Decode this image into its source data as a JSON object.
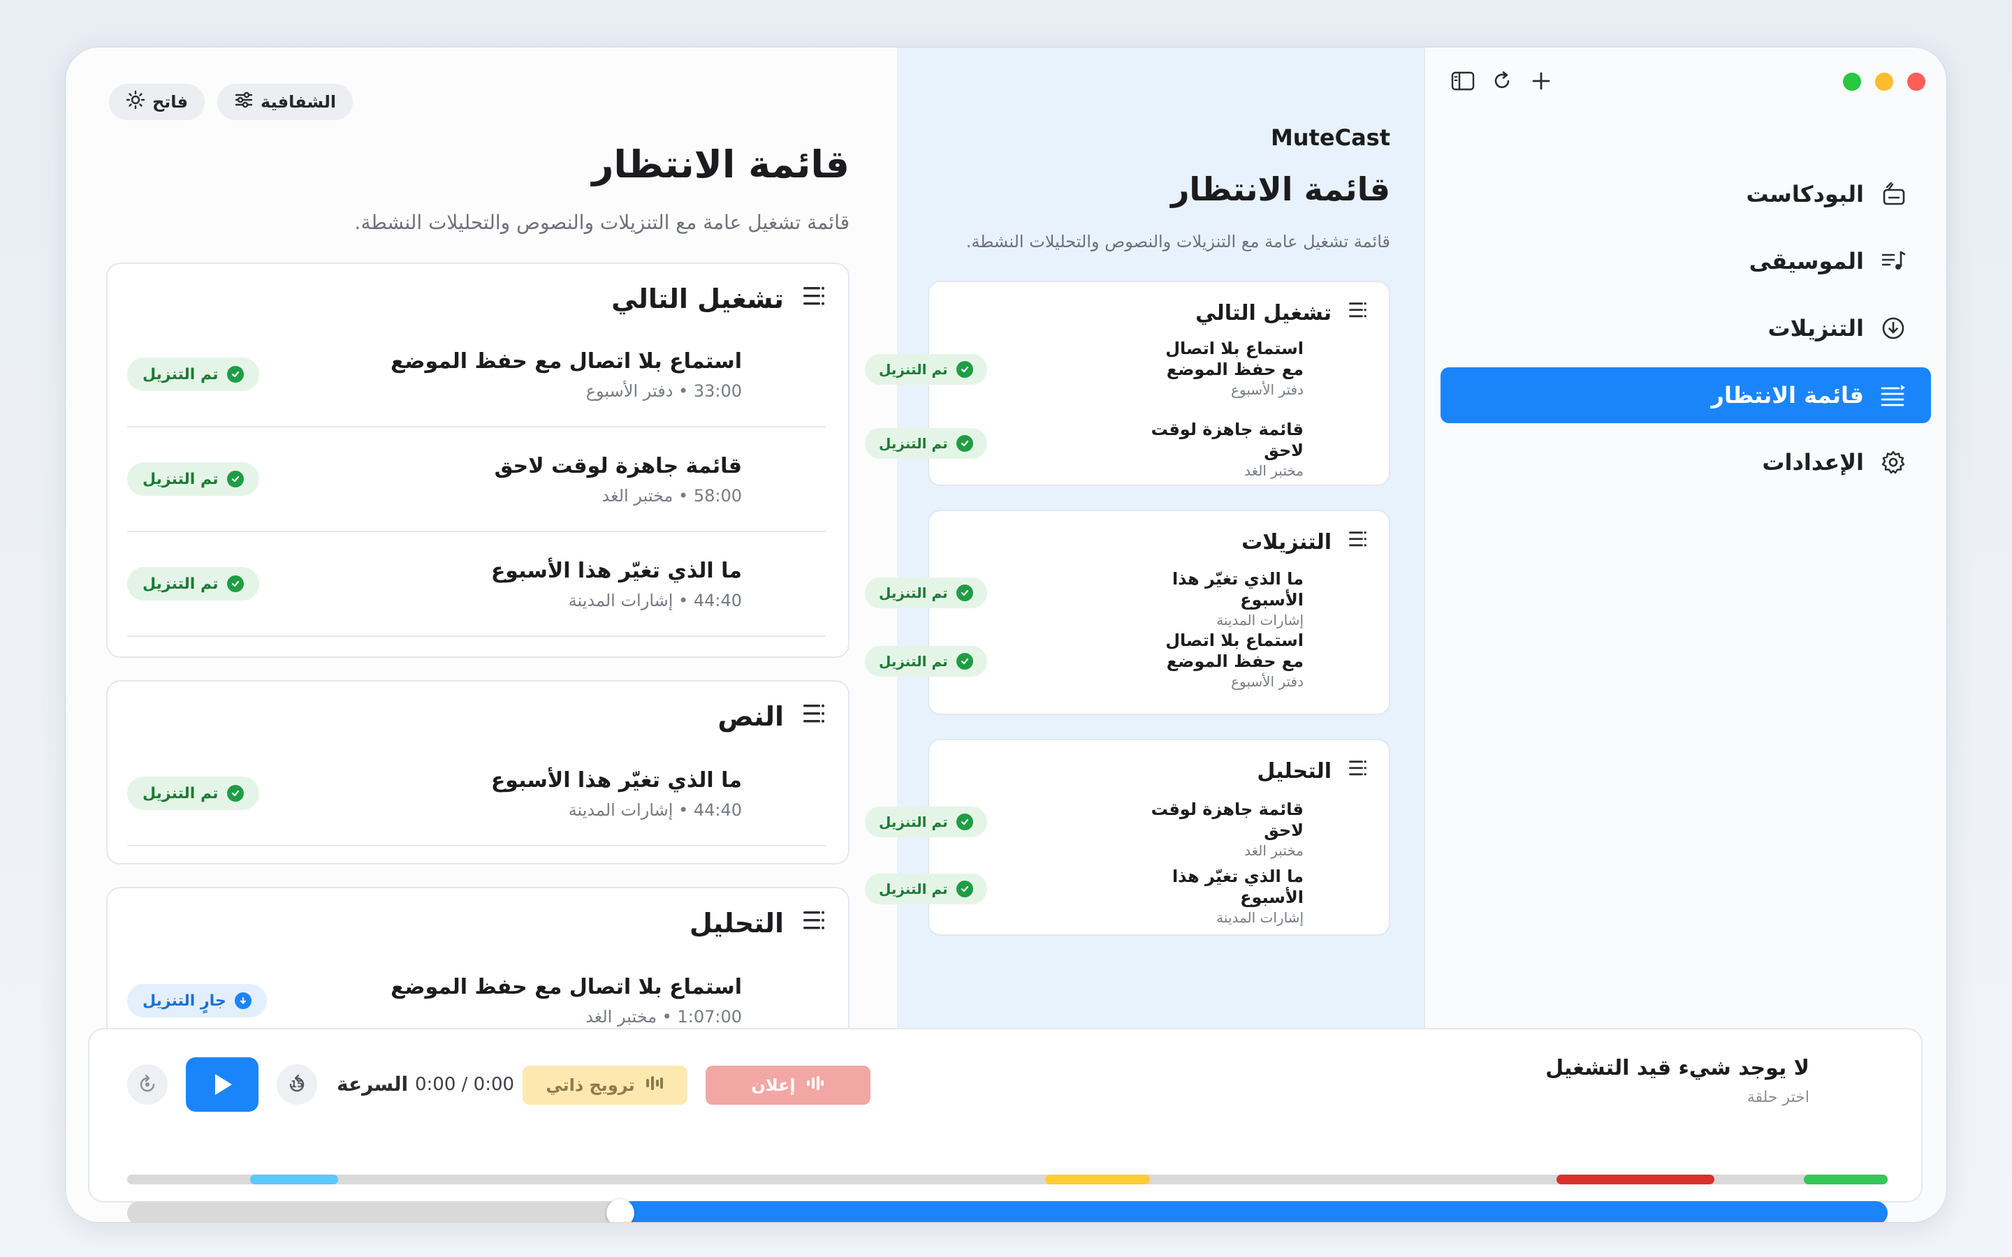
{
  "app": {
    "name": "MuteCast"
  },
  "sidebar": {
    "items": [
      {
        "label": "البودكاست",
        "icon": "podcast-icon"
      },
      {
        "label": "الموسيقى",
        "icon": "music-icon"
      },
      {
        "label": "التنزيلات",
        "icon": "download-icon"
      },
      {
        "label": "قائمة الانتظار",
        "icon": "queue-icon",
        "active": true
      },
      {
        "label": "الإعدادات",
        "icon": "gear-icon"
      }
    ]
  },
  "middle": {
    "title": "قائمة الانتظار",
    "subtitle": "قائمة تشغيل عامة مع التنزيلات والنصوص والتحليلات النشطة.",
    "cards": [
      {
        "title": "تشغيل التالي",
        "rows": [
          {
            "title": "استماع بلا اتصال مع حفظ الموضع",
            "subtitle": "دفتر الأسبوع",
            "badge": "تم التنزيل"
          },
          {
            "title": "قائمة جاهزة لوقت لاحق",
            "subtitle": "مختبر الغد",
            "badge": "تم التنزيل"
          }
        ]
      },
      {
        "title": "التنزيلات",
        "rows": [
          {
            "title": "ما الذي تغيّر هذا الأسبوع",
            "subtitle": "إشارات المدينة",
            "badge": "تم التنزيل"
          },
          {
            "title": "استماع بلا اتصال مع حفظ الموضع",
            "subtitle": "دفتر الأسبوع",
            "badge": "تم التنزيل"
          }
        ]
      },
      {
        "title": "التحليل",
        "rows": [
          {
            "title": "قائمة جاهزة لوقت لاحق",
            "subtitle": "مختبر الغد",
            "badge": "تم التنزيل"
          },
          {
            "title": "ما الذي تغيّر هذا الأسبوع",
            "subtitle": "إشارات المدينة",
            "badge": "تم التنزيل"
          }
        ]
      }
    ]
  },
  "main": {
    "pills": {
      "transparency": "الشفافية",
      "theme": "فاتح"
    },
    "title": "قائمة الانتظار",
    "subtitle": "قائمة تشغيل عامة مع التنزيلات والنصوص والتحليلات النشطة.",
    "cards": [
      {
        "title": "تشغيل التالي",
        "rows": [
          {
            "title": "استماع بلا اتصال مع حفظ الموضع",
            "subtitle": "33:00 • دفتر الأسبوع",
            "badge": "تم التنزيل"
          },
          {
            "title": "قائمة جاهزة لوقت لاحق",
            "subtitle": "58:00 • مختبر الغد",
            "badge": "تم التنزيل"
          },
          {
            "title": "ما الذي تغيّر هذا الأسبوع",
            "subtitle": "44:40 • إشارات المدينة",
            "badge": "تم التنزيل"
          }
        ]
      },
      {
        "title": "النص",
        "rows": [
          {
            "title": "ما الذي تغيّر هذا الأسبوع",
            "subtitle": "44:40 • إشارات المدينة",
            "badge": "تم التنزيل"
          }
        ]
      },
      {
        "title": "التحليل",
        "rows": [
          {
            "title": "استماع بلا اتصال مع حفظ الموضع",
            "subtitle": "1:07:00 • مختبر الغد",
            "badge": "جارٍ التنزيل"
          }
        ]
      }
    ]
  },
  "player": {
    "now_playing_title": "لا يوجد شيء قيد التشغيل",
    "now_playing_subtitle": "اختر حلقة",
    "speed_label": "السرعة",
    "time": "0:00 / 0:00",
    "promo_label": "ترويج ذاتي",
    "ad_label": "إعلان",
    "skip_back_label": "15",
    "progress_fraction": 0.72
  },
  "colors": {
    "accent": "#1a85fb",
    "downloaded_badge": "#1f9d45",
    "downloading_badge": "#1a85fb",
    "segment_intro": "#5ac8fa",
    "segment_promo": "#ffcc33",
    "segment_ad": "#d9302c",
    "segment_outro": "#34c759"
  }
}
